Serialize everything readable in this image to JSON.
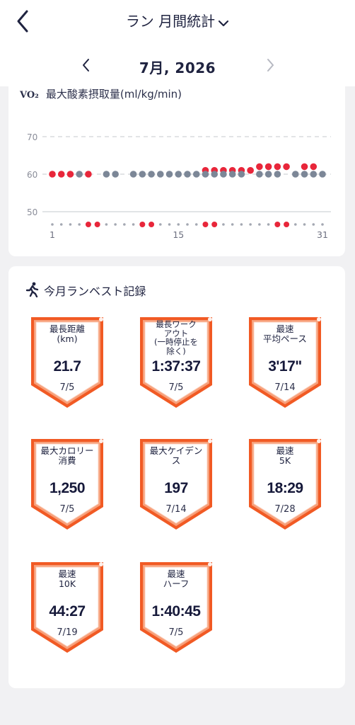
{
  "header": {
    "title": "ラン 月間統計",
    "month": "7月, 2026"
  },
  "chart": {
    "title_prefix": "VO₂",
    "title": "最大酸素摂取量(ml/kg/min)",
    "y_ticks": [
      "70",
      "60",
      "50"
    ],
    "x_ticks": [
      "1",
      "15",
      "31"
    ]
  },
  "chart_data": {
    "type": "scatter",
    "title": "最大酸素摂取量(ml/kg/min)",
    "ylim": [
      50,
      70
    ],
    "x": [
      1,
      31
    ],
    "grid": true,
    "series": [
      {
        "color": "#e8263a",
        "points": [
          [
            1,
            60
          ],
          [
            2,
            60
          ],
          [
            3,
            60
          ],
          [
            5,
            60
          ],
          [
            18,
            61
          ],
          [
            19,
            61
          ],
          [
            20,
            61
          ],
          [
            21,
            61
          ],
          [
            22,
            61
          ],
          [
            23,
            61
          ],
          [
            24,
            62
          ],
          [
            25,
            62
          ],
          [
            26,
            62
          ],
          [
            27,
            62
          ],
          [
            29,
            62
          ],
          [
            30,
            62
          ]
        ]
      },
      {
        "color": "#7c8797",
        "points": [
          [
            4,
            60
          ],
          [
            7,
            60
          ],
          [
            8,
            60
          ],
          [
            10,
            60
          ],
          [
            11,
            60
          ],
          [
            12,
            60
          ],
          [
            13,
            60
          ],
          [
            14,
            60
          ],
          [
            15,
            60
          ],
          [
            16,
            60
          ],
          [
            17,
            60
          ],
          [
            18,
            60
          ],
          [
            19,
            60
          ],
          [
            20,
            60
          ],
          [
            21,
            60
          ],
          [
            22,
            60
          ],
          [
            24,
            60
          ],
          [
            25,
            60
          ],
          [
            26,
            60
          ],
          [
            28,
            60
          ],
          [
            29,
            60
          ],
          [
            30,
            60
          ],
          [
            31,
            60
          ]
        ]
      }
    ],
    "activity_days": [
      5,
      6,
      11,
      12,
      18,
      19,
      26,
      27
    ]
  },
  "best": {
    "title": "今月ランベスト記録",
    "records": [
      {
        "label": "最長距離\n(km)",
        "value": "21.7",
        "date": "7/5"
      },
      {
        "label": "最長ワーク\nアウト\n(一時停止を\n除く)",
        "value": "1:37:37",
        "date": "7/5"
      },
      {
        "label": "最速\n平均ペース",
        "value": "3'17\"",
        "date": "7/14"
      },
      {
        "label": "最大カロリー\n消費",
        "value": "1,250",
        "date": "7/5"
      },
      {
        "label": "最大ケイデン\nス",
        "value": "197",
        "date": "7/14"
      },
      {
        "label": "最速\n5K",
        "value": "18:29",
        "date": "7/28"
      },
      {
        "label": "最速\n10K",
        "value": "44:27",
        "date": "7/19"
      },
      {
        "label": "最速\nハーフ",
        "value": "1:40:45",
        "date": "7/5"
      }
    ]
  },
  "colors": {
    "accent": "#e8263a",
    "badge_border": "#f15a24",
    "gray_dot": "#7c8797"
  }
}
